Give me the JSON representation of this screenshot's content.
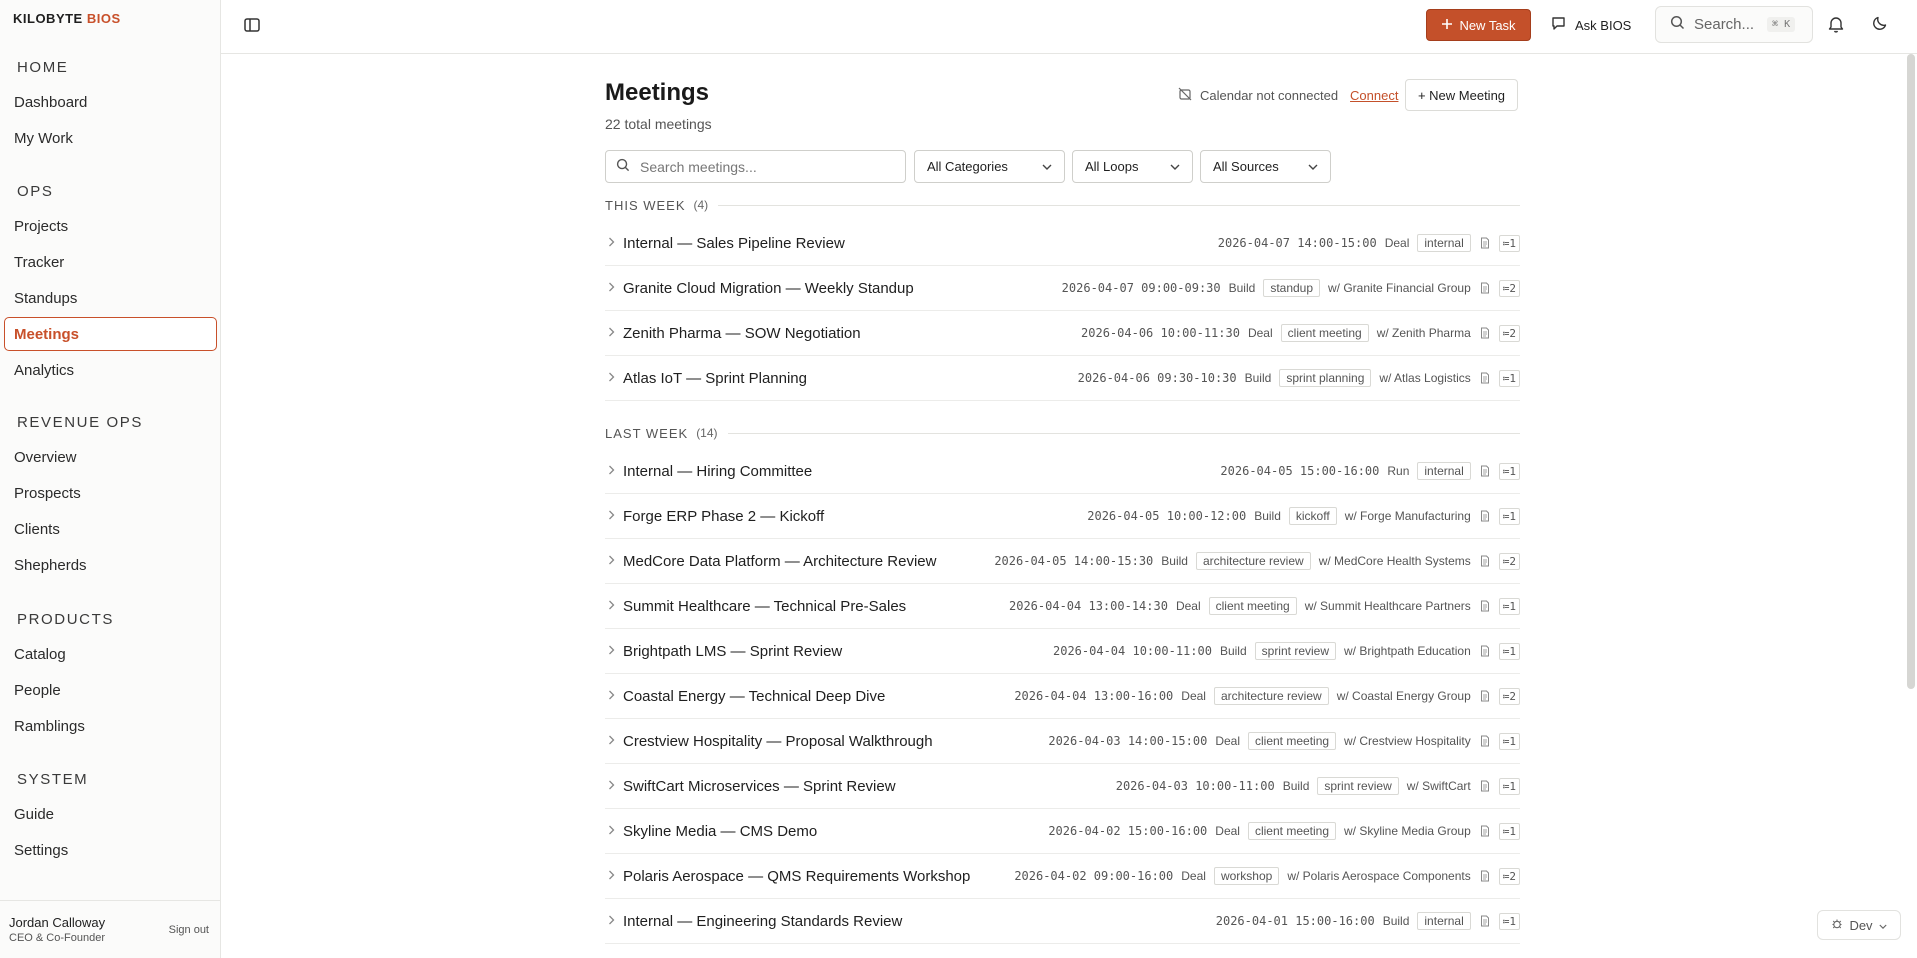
{
  "brand": {
    "name": "KILOBYTE",
    "accent": "BIOS"
  },
  "sidebar": {
    "sections": [
      {
        "title": "HOME",
        "items": [
          {
            "label": "Dashboard"
          },
          {
            "label": "My Work"
          }
        ]
      },
      {
        "title": "OPS",
        "items": [
          {
            "label": "Projects"
          },
          {
            "label": "Tracker"
          },
          {
            "label": "Standups"
          },
          {
            "label": "Meetings",
            "active": true
          },
          {
            "label": "Analytics"
          }
        ]
      },
      {
        "title": "REVENUE OPS",
        "items": [
          {
            "label": "Overview"
          },
          {
            "label": "Prospects"
          },
          {
            "label": "Clients"
          },
          {
            "label": "Shepherds"
          }
        ]
      },
      {
        "title": "PRODUCTS",
        "items": [
          {
            "label": "Catalog"
          },
          {
            "label": "People"
          },
          {
            "label": "Ramblings"
          }
        ]
      },
      {
        "title": "SYSTEM",
        "items": [
          {
            "label": "Guide"
          },
          {
            "label": "Settings"
          }
        ]
      }
    ],
    "user": {
      "name": "Jordan Calloway",
      "role": "CEO & Co-Founder",
      "sign_out": "Sign out"
    }
  },
  "topbar": {
    "new_task": "New Task",
    "ask_bios": "Ask BIOS",
    "search_placeholder": "Search...",
    "search_shortcut": "⌘ K"
  },
  "page": {
    "title": "Meetings",
    "subtitle": "22 total meetings",
    "calendar_status": "Calendar not connected",
    "connect": "Connect",
    "new_meeting": "+ New Meeting"
  },
  "filters": {
    "search_placeholder": "Search meetings...",
    "categories": "All Categories",
    "loops": "All Loops",
    "sources": "All Sources"
  },
  "groups": [
    {
      "label": "THIS WEEK",
      "count": "(4)",
      "meetings": [
        {
          "title": "Internal — Sales Pipeline Review",
          "when": "2026-04-07 14:00-15:00",
          "category": "Deal",
          "tag": "internal",
          "with": "",
          "loops": "1"
        },
        {
          "title": "Granite Cloud Migration — Weekly Standup",
          "when": "2026-04-07 09:00-09:30",
          "category": "Build",
          "tag": "standup",
          "with": "w/ Granite Financial Group",
          "loops": "2"
        },
        {
          "title": "Zenith Pharma — SOW Negotiation",
          "when": "2026-04-06 10:00-11:30",
          "category": "Deal",
          "tag": "client meeting",
          "with": "w/ Zenith Pharma",
          "loops": "2"
        },
        {
          "title": "Atlas IoT — Sprint Planning",
          "when": "2026-04-06 09:30-10:30",
          "category": "Build",
          "tag": "sprint planning",
          "with": "w/ Atlas Logistics",
          "loops": "1"
        }
      ]
    },
    {
      "label": "LAST WEEK",
      "count": "(14)",
      "meetings": [
        {
          "title": "Internal — Hiring Committee",
          "when": "2026-04-05 15:00-16:00",
          "category": "Run",
          "tag": "internal",
          "with": "",
          "loops": "1"
        },
        {
          "title": "Forge ERP Phase 2 — Kickoff",
          "when": "2026-04-05 10:00-12:00",
          "category": "Build",
          "tag": "kickoff",
          "with": "w/ Forge Manufacturing",
          "loops": "1"
        },
        {
          "title": "MedCore Data Platform — Architecture Review",
          "when": "2026-04-05 14:00-15:30",
          "category": "Build",
          "tag": "architecture review",
          "with": "w/ MedCore Health Systems",
          "loops": "2"
        },
        {
          "title": "Summit Healthcare — Technical Pre-Sales",
          "when": "2026-04-04 13:00-14:30",
          "category": "Deal",
          "tag": "client meeting",
          "with": "w/ Summit Healthcare Partners",
          "loops": "1"
        },
        {
          "title": "Brightpath LMS — Sprint Review",
          "when": "2026-04-04 10:00-11:00",
          "category": "Build",
          "tag": "sprint review",
          "with": "w/ Brightpath Education",
          "loops": "1"
        },
        {
          "title": "Coastal Energy — Technical Deep Dive",
          "when": "2026-04-04 13:00-16:00",
          "category": "Deal",
          "tag": "architecture review",
          "with": "w/ Coastal Energy Group",
          "loops": "2"
        },
        {
          "title": "Crestview Hospitality — Proposal Walkthrough",
          "when": "2026-04-03 14:00-15:00",
          "category": "Deal",
          "tag": "client meeting",
          "with": "w/ Crestview Hospitality",
          "loops": "1"
        },
        {
          "title": "SwiftCart Microservices — Sprint Review",
          "when": "2026-04-03 10:00-11:00",
          "category": "Build",
          "tag": "sprint review",
          "with": "w/ SwiftCart",
          "loops": "1"
        },
        {
          "title": "Skyline Media — CMS Demo",
          "when": "2026-04-02 15:00-16:00",
          "category": "Deal",
          "tag": "client meeting",
          "with": "w/ Skyline Media Group",
          "loops": "1"
        },
        {
          "title": "Polaris Aerospace — QMS Requirements Workshop",
          "when": "2026-04-02 09:00-16:00",
          "category": "Deal",
          "tag": "workshop",
          "with": "w/ Polaris Aerospace Components",
          "loops": "2"
        },
        {
          "title": "Internal — Engineering Standards Review",
          "when": "2026-04-01 15:00-16:00",
          "category": "Build",
          "tag": "internal",
          "with": "",
          "loops": "1"
        }
      ]
    }
  ],
  "dev_badge": "Dev",
  "colors": {
    "accent": "#c4502a",
    "border": "#e6e6e3"
  },
  "icons": [
    "sidebar-toggle-icon",
    "plus-icon",
    "chat-icon",
    "search-icon",
    "bell-icon",
    "moon-icon",
    "calendar-off-icon",
    "chevron-right-icon",
    "chevron-down-icon",
    "document-icon",
    "loop-icon",
    "bug-icon"
  ]
}
